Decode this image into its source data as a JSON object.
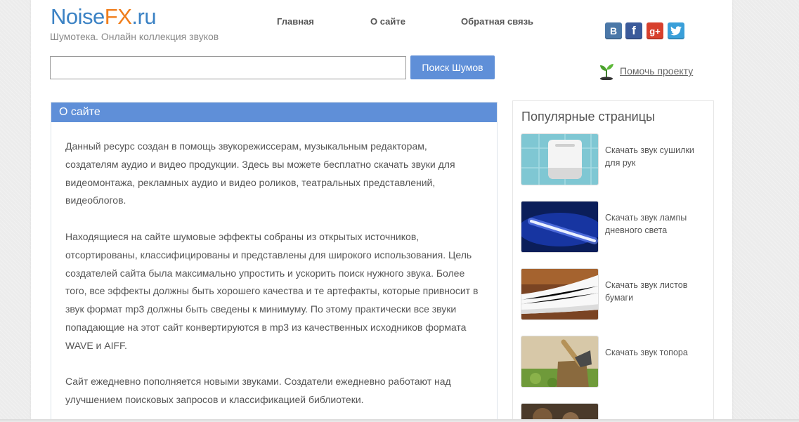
{
  "header": {
    "logo": {
      "part1": "Noise",
      "part2": "FX",
      "part3": ".ru"
    },
    "tagline": "Шумотека. Онлайн коллекция звуков",
    "nav": [
      "Главная",
      "О сайте",
      "Обратная связь"
    ],
    "social": [
      {
        "icon": "vk-icon",
        "glyph": "B",
        "color": "#4b78a8"
      },
      {
        "icon": "facebook-icon",
        "glyph": "f",
        "color": "#3b5a9a"
      },
      {
        "icon": "google-plus-icon",
        "glyph": "g+",
        "color": "#d7402d"
      },
      {
        "icon": "twitter-icon",
        "glyph": "t",
        "color": "#3a9fd9"
      }
    ]
  },
  "search": {
    "value": "",
    "button": "Поиск Шумов"
  },
  "help": {
    "label": "Помочь проекту",
    "icon": "sprout-icon"
  },
  "content": {
    "title": "О сайте",
    "paragraphs": [
      "Данный ресурс создан в помощь звукорежиссерам, музыкальным редакторам, создателям аудио и видео продукции. Здесь вы можете бесплатно скачать звуки для видеомонтажа, рекламных аудио и видео роликов, театральных представлений, видеоблогов.",
      "Находящиеся на сайте шумовые эффекты собраны из открытых источников, отсортированы, классифицированы и представлены для широкого использования. Цель создателей сайта была максимально упростить и ускорить поиск нужного звука. Более того, все эффекты должны быть хорошего качества и те артефакты, которые привносит в звук формат mp3 должны быть сведены к минимуму. По этому практически все звуки попадающие на этот сайт конвертируются в mp3 из качественных исходников формата WAVE и AIFF.",
      "Сайт ежедневно пополняется новыми звуками. Создатели ежедневно работают над  улучшением поисковых запросов и классификацией библиотеки."
    ]
  },
  "sidebar": {
    "title": "Популярные страницы",
    "items": [
      {
        "label": "Скачать звук сушилки для рук"
      },
      {
        "label": "Скачать звук лампы дневного света"
      },
      {
        "label": "Скачать звук листов бумаги"
      },
      {
        "label": "Скачать звук топора"
      }
    ]
  },
  "colors": {
    "accent": "#5f8fd8",
    "logo_blue": "#3b82c4",
    "logo_orange": "#f07e1c"
  }
}
